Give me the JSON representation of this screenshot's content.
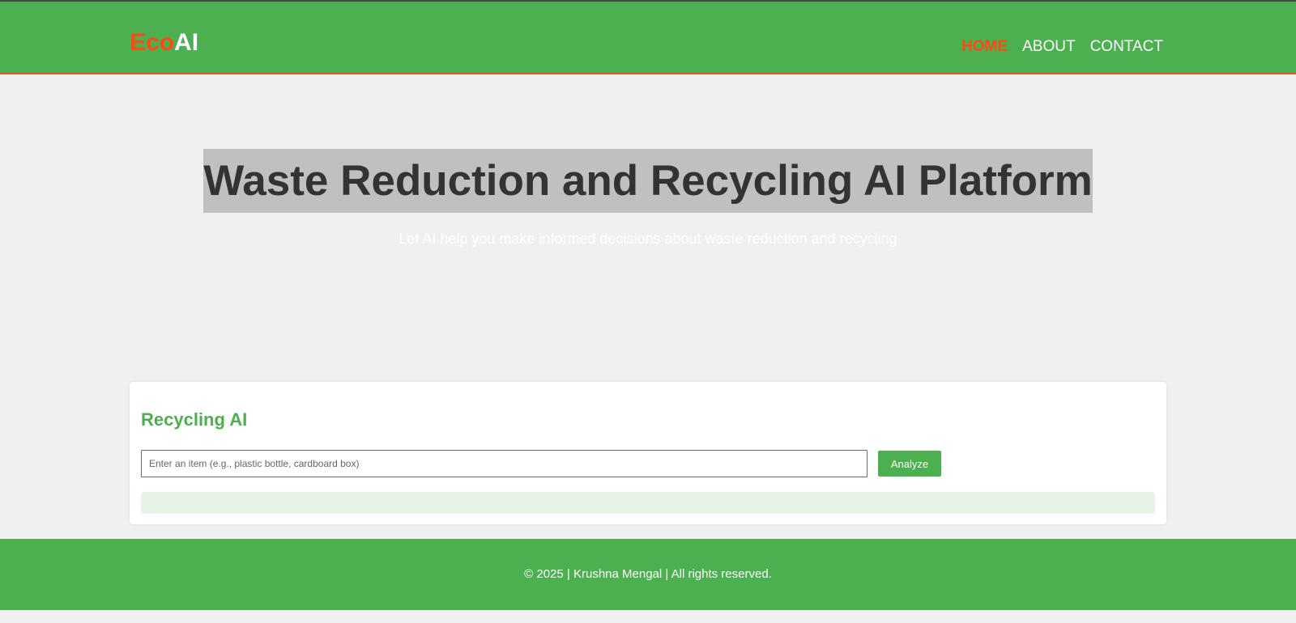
{
  "header": {
    "logo_part1": "Eco",
    "logo_part2": "AI",
    "nav": [
      {
        "label": "HOME",
        "active": true
      },
      {
        "label": "ABOUT",
        "active": false
      },
      {
        "label": "CONTACT",
        "active": false
      }
    ]
  },
  "hero": {
    "title": "Waste Reduction and Recycling AI Platform",
    "subtitle": "Let AI help you make informed decisions about waste reduction and recycling"
  },
  "recycling": {
    "title": "Recycling AI",
    "input_placeholder": "Enter an item (e.g., plastic bottle, cardboard box)",
    "input_value": "",
    "button_label": "Analyze",
    "result_text": ""
  },
  "footer": {
    "text": "© 2025 | Krushna Mengal | All rights reserved."
  },
  "colors": {
    "brand_green": "#4caf50",
    "accent_orange": "#ff4a12",
    "page_background": "#f0f0f0",
    "result_background": "#e8f3e8"
  }
}
